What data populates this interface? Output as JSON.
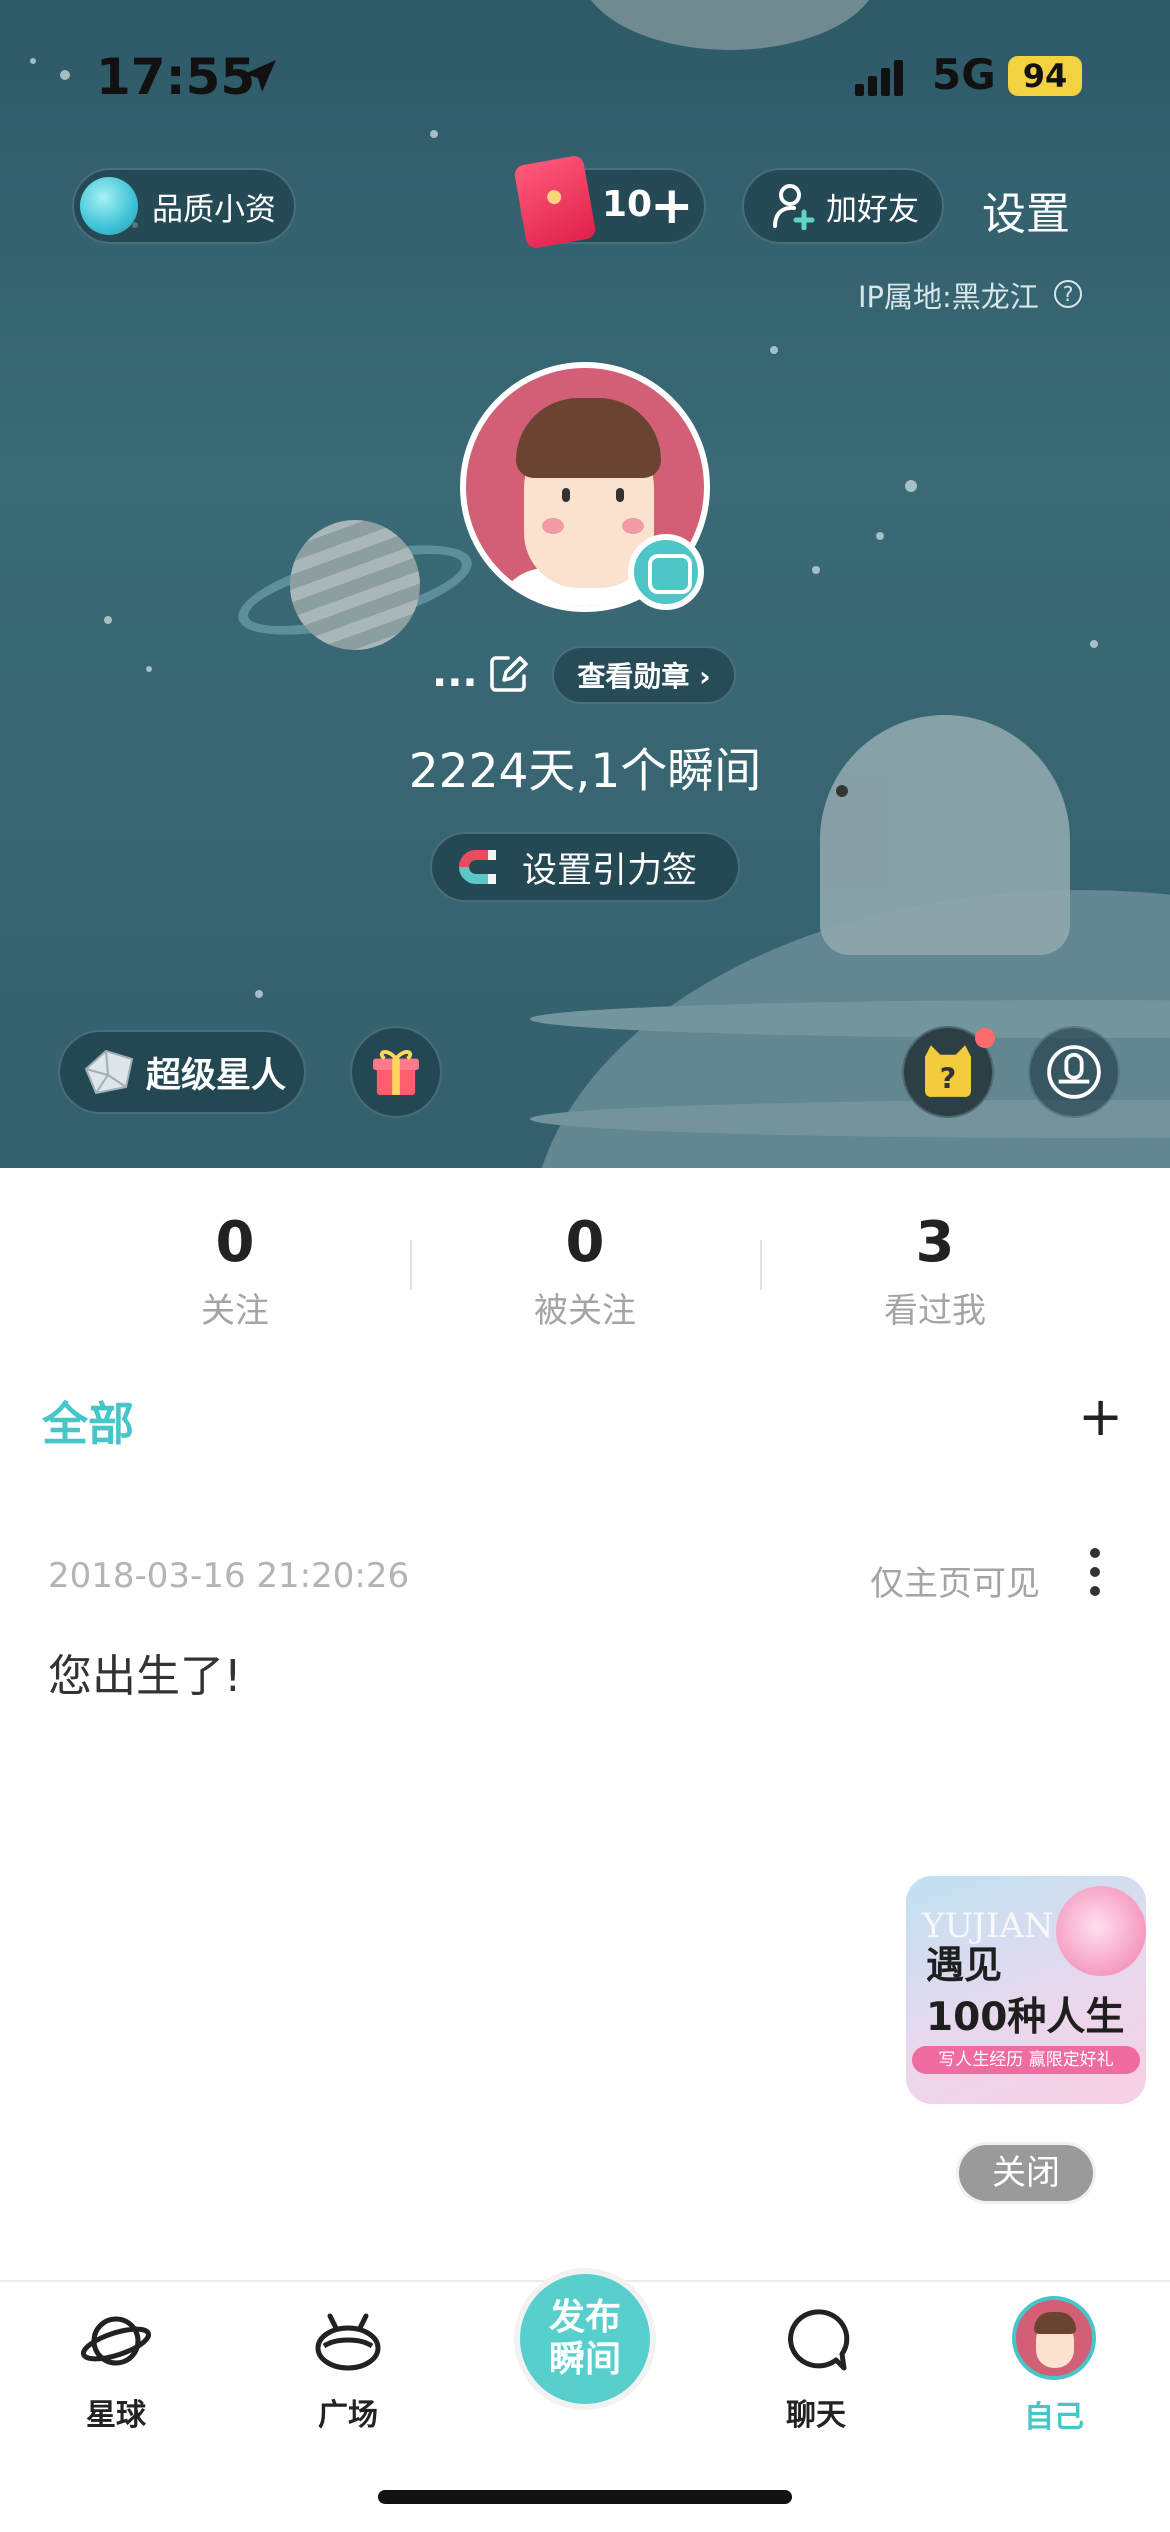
{
  "status_bar": {
    "time": "17:55",
    "network": "5G",
    "battery": "94"
  },
  "header": {
    "quality_label": "品质小资",
    "redpack_count": "10",
    "plus_label": "+",
    "add_friend_label": "加好友",
    "settings_label": "设置",
    "ip_location": "IP属地:黑龙江",
    "help_glyph": "?"
  },
  "profile": {
    "nickname": "...",
    "medal_button": "查看勋章 ›",
    "days_text": "2224天,1个瞬间",
    "gravity_button": "设置引力签",
    "superstar_label": "超级星人"
  },
  "stats": [
    {
      "value": "0",
      "label": "关注"
    },
    {
      "value": "0",
      "label": "被关注"
    },
    {
      "value": "3",
      "label": "看过我"
    }
  ],
  "feed": {
    "tab_label": "全部",
    "add_label": "+",
    "post": {
      "time": "2018-03-16 21:20:26",
      "visibility": "仅主页可见",
      "text": "您出生了!"
    }
  },
  "ad": {
    "bg_text": "YUJIAN",
    "title_line1": "遇见",
    "title_line2": "100种人生",
    "subtitle": "写人生经历 赢限定好礼",
    "close_label": "关闭"
  },
  "bottom_nav": {
    "planet": "星球",
    "square": "广场",
    "publish_line1": "发布",
    "publish_line2": "瞬间",
    "chat": "聊天",
    "self": "自己"
  },
  "colors": {
    "accent": "#46c6c8",
    "hero_bg": "#34606d",
    "publish_bg": "#58cfcc"
  }
}
